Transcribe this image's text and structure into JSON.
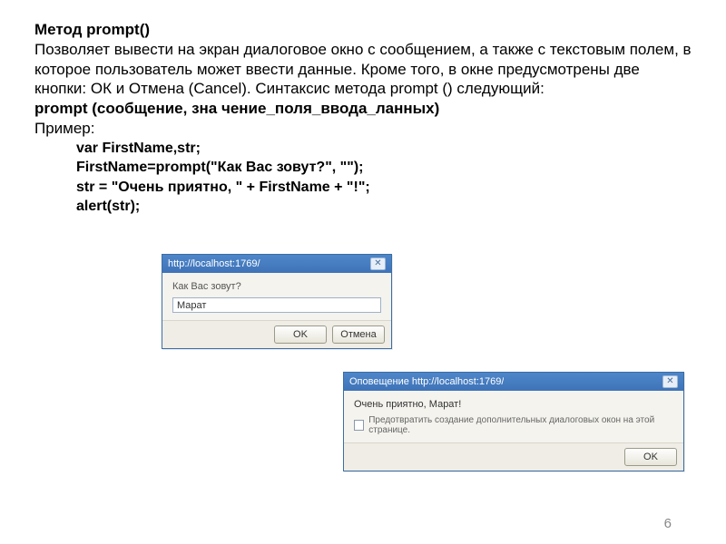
{
  "heading": "Метод prompt()",
  "paragraph": "Позволяет вывести на экран диалоговое окно с сообщением, а также с текстовым полем, в которое пользователь может ввести данные. Кроме того, в окне предусмотрены две кнопки: ОК и Отмена (Cancel). Синтаксис метода prompt () следующий:",
  "syntax": "prompt (сообщение, зна чение_поля_ввода_ланных)",
  "example_label": "Пример:",
  "code": {
    "l1": "var FirstName,str;",
    "l2": "FirstName=prompt(\"Как Вас зовут?\", \"\");",
    "l3": "str = \"Очень приятно, \" + FirstName + \"!\";",
    "l4": "alert(str);"
  },
  "dialog1": {
    "title": "http://localhost:1769/",
    "message": "Как Вас зовут?",
    "input_value": "Марат",
    "ok": "OK",
    "cancel": "Отмена"
  },
  "dialog2": {
    "title": "Оповещение http://localhost:1769/",
    "message": "Очень приятно, Марат!",
    "checkbox_label": "Предотвратить создание дополнительных диалоговых окон на этой странице.",
    "ok": "OK"
  },
  "page_number": "6"
}
